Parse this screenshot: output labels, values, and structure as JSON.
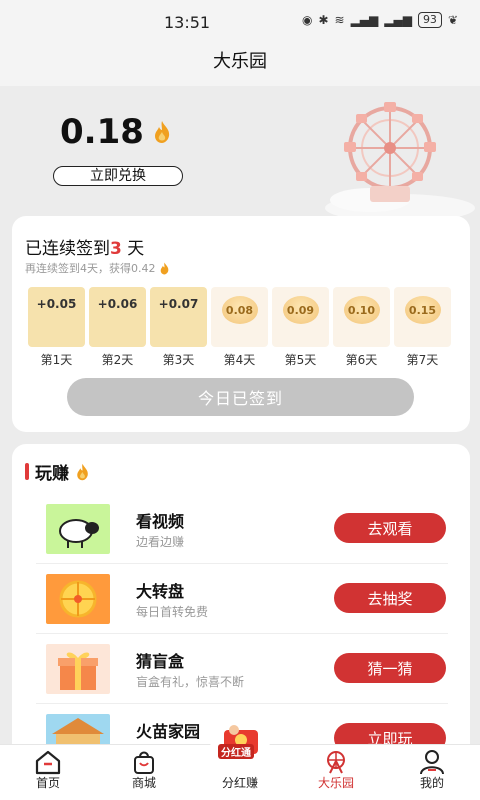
{
  "status_bar": {
    "time": "13:51",
    "battery": "93"
  },
  "nav": {
    "title": "大乐园"
  },
  "header": {
    "balance": "0.18",
    "exchange_label": "立即兑换"
  },
  "checkin": {
    "title_prefix": "已连续签到",
    "days_count": "3",
    "title_suffix": " 天",
    "subtitle": "再连续签到4天，获得0.42",
    "days": [
      {
        "value": "+0.05",
        "label": "第1天",
        "state": "done"
      },
      {
        "value": "+0.06",
        "label": "第2天",
        "state": "done"
      },
      {
        "value": "+0.07",
        "label": "第3天",
        "state": "done"
      },
      {
        "value": "0.08",
        "label": "第4天",
        "state": "todo"
      },
      {
        "value": "0.09",
        "label": "第5天",
        "state": "todo"
      },
      {
        "value": "0.10",
        "label": "第6天",
        "state": "todo"
      },
      {
        "value": "0.15",
        "label": "第7天",
        "state": "todo"
      }
    ],
    "signed_label": "今日已签到"
  },
  "play": {
    "heading": "玩赚",
    "tasks": [
      {
        "name": "看视频",
        "desc": "边看边赚",
        "button": "去观看"
      },
      {
        "name": "大转盘",
        "desc": "每日首转免费",
        "button": "去抽奖"
      },
      {
        "name": "猜盲盒",
        "desc": "盲盒有礼，惊喜不断",
        "button": "猜一猜"
      },
      {
        "name": "火苗家园",
        "desc": "",
        "button": "立即玩"
      }
    ]
  },
  "fenhong_badge": "分红通",
  "tabs": [
    {
      "label": "首页",
      "icon": "home-icon"
    },
    {
      "label": "商城",
      "icon": "shopping-bag-icon"
    },
    {
      "label": "分红赚",
      "icon": "red-envelope-icon"
    },
    {
      "label": "大乐园",
      "icon": "ferris-wheel-icon"
    },
    {
      "label": "我的",
      "icon": "user-icon"
    }
  ],
  "colors": {
    "accent": "#d13333",
    "done_tile": "#f6e2ad",
    "todo_tile": "#fbf3e8"
  }
}
